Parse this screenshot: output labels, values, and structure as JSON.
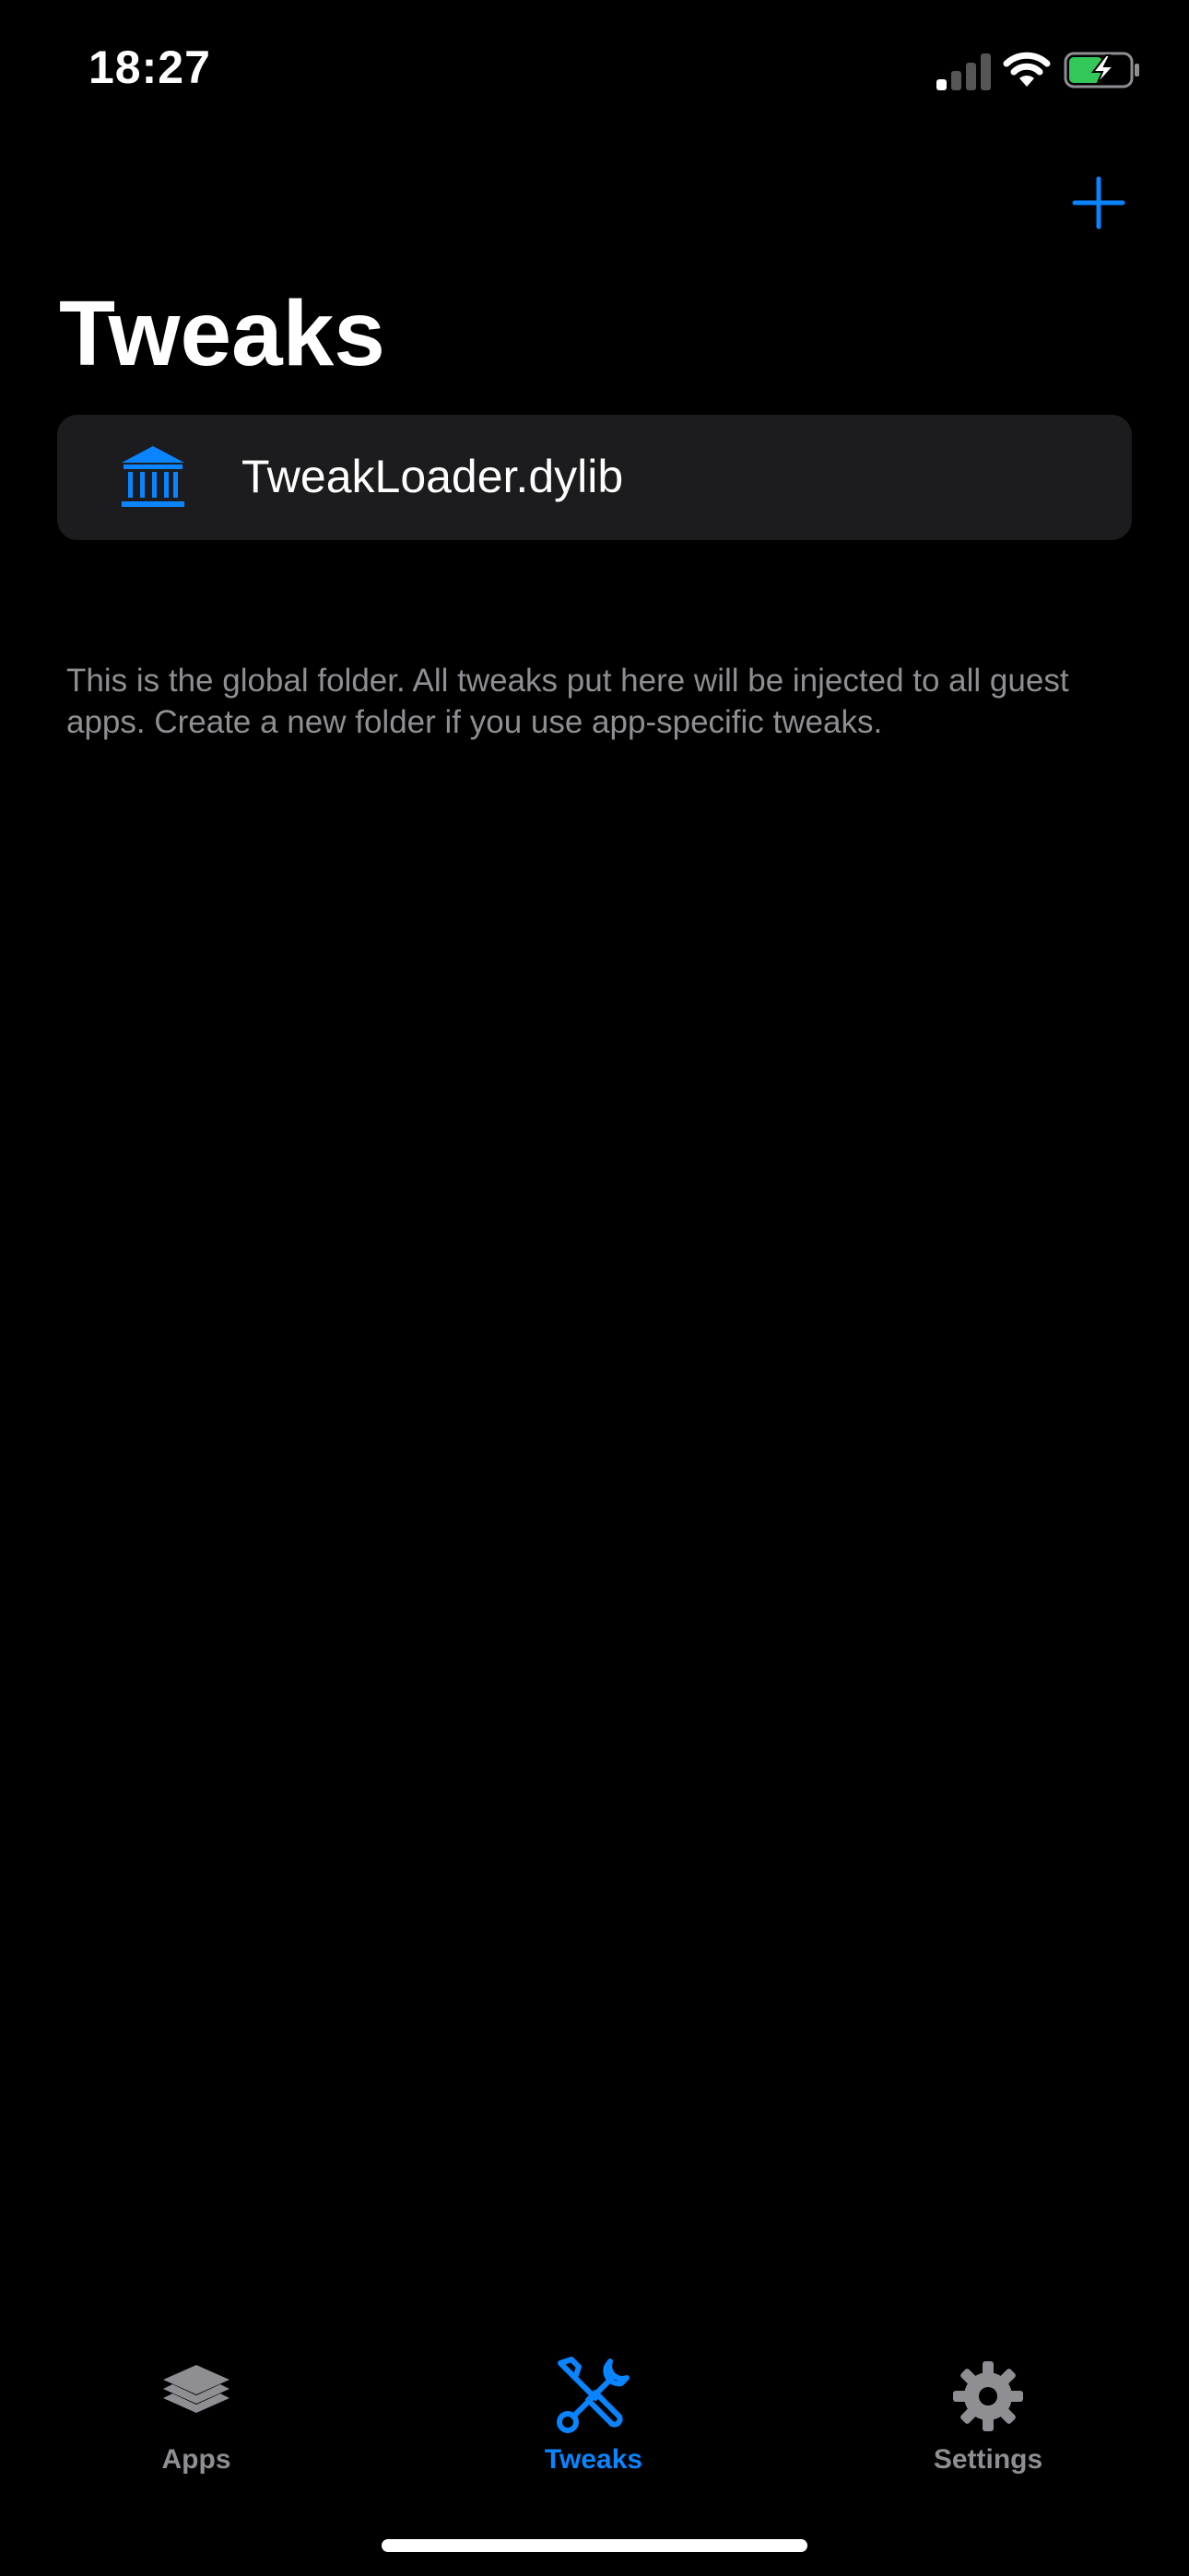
{
  "status_bar": {
    "time": "18:27",
    "icons": [
      "cellular-signal-icon",
      "wifi-icon",
      "battery-charging-icon"
    ]
  },
  "nav": {
    "title": "Tweaks",
    "add_icon": "plus-icon"
  },
  "list": {
    "items": [
      {
        "label": "TweakLoader.dylib",
        "icon": "bank-building-icon"
      }
    ],
    "footer": "This is the global folder. All tweaks put here will be injected to all guest apps. Create a new folder if you use app-specific tweaks."
  },
  "tab_bar": {
    "tabs": [
      {
        "label": "Apps",
        "icon": "stack-layers-icon",
        "active": false
      },
      {
        "label": "Tweaks",
        "icon": "wrench-screwdriver-icon",
        "active": true
      },
      {
        "label": "Settings",
        "icon": "gear-icon",
        "active": false
      }
    ]
  },
  "colors": {
    "accent": "#0a84ff",
    "background": "#000000",
    "card": "#1c1c1e",
    "secondary_text": "#8e8e93",
    "battery_charging": "#34c759"
  }
}
